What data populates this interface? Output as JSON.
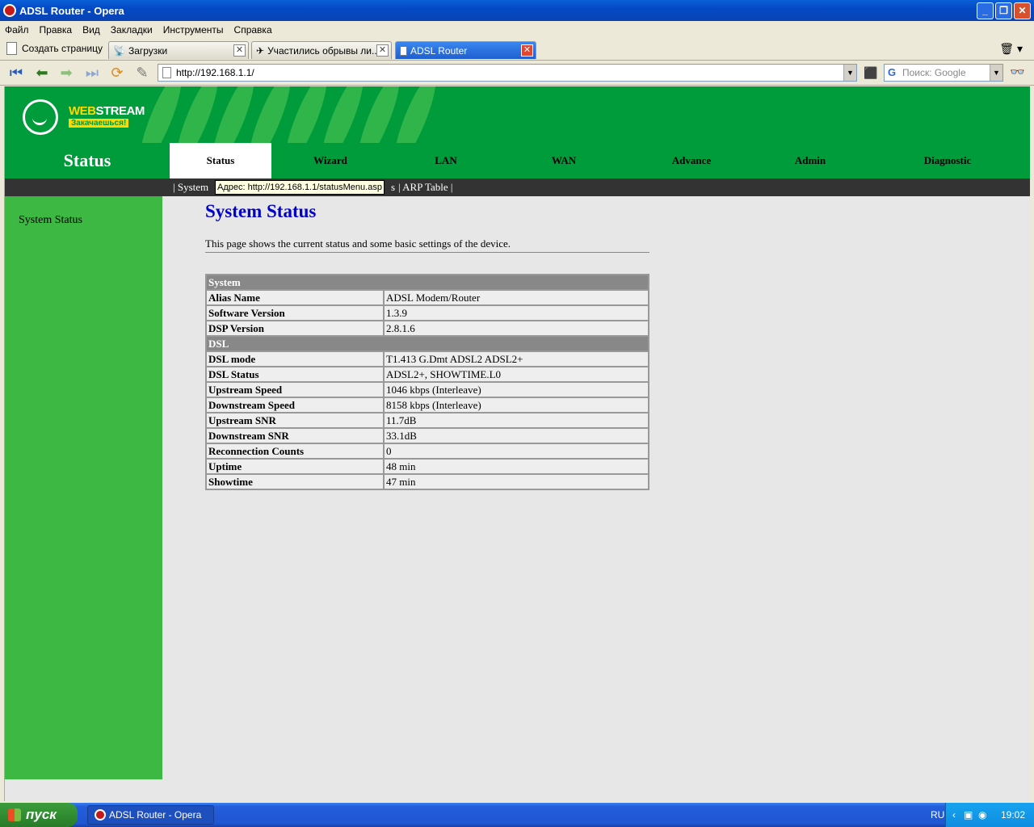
{
  "window": {
    "title": "ADSL Router - Opera"
  },
  "menu": [
    "Файл",
    "Правка",
    "Вид",
    "Закладки",
    "Инструменты",
    "Справка"
  ],
  "tabbar": {
    "new_page": "Создать страницу",
    "tabs": [
      {
        "label": "Загрузки"
      },
      {
        "label": "Участились обрывы ли..."
      },
      {
        "label": "ADSL Router"
      }
    ]
  },
  "navbar": {
    "address": "http://192.168.1.1/",
    "search_placeholder": "Поиск: Google"
  },
  "router": {
    "logo_web": "WEB",
    "logo_stream": "STREAM",
    "logo_tagline": "Закачаешься!",
    "section_title": "Status",
    "menu": [
      "Status",
      "Wizard",
      "LAN",
      "WAN",
      "Advance",
      "Admin",
      "Diagnostic"
    ],
    "submenu_left": "| System",
    "submenu_tail": "s",
    "submenu_right": "| ARP Table |",
    "tooltip": "Адрес: http://192.168.1.1/statusMenu.asp",
    "sidebar_item": "System Status",
    "page_title": "System Status",
    "description": "This page shows the current status and some basic settings of the device.",
    "table": [
      {
        "header": "System"
      },
      {
        "key": "Alias Name",
        "value": "ADSL Modem/Router"
      },
      {
        "key": "Software Version",
        "value": "1.3.9"
      },
      {
        "key": "DSP Version",
        "value": "2.8.1.6"
      },
      {
        "header": "DSL"
      },
      {
        "key": "DSL mode",
        "value": "T1.413 G.Dmt ADSL2 ADSL2+"
      },
      {
        "key": "DSL Status",
        "value": "ADSL2+, SHOWTIME.L0"
      },
      {
        "key": "Upstream Speed",
        "value": "1046 kbps  (Interleave)"
      },
      {
        "key": "Downstream Speed",
        "value": "8158 kbps  (Interleave)"
      },
      {
        "key": "Upstream SNR",
        "value": "11.7dB"
      },
      {
        "key": "Downstream SNR",
        "value": "33.1dB"
      },
      {
        "key": "Reconnection Counts",
        "value": "0"
      },
      {
        "key": "Uptime",
        "value": "48 min"
      },
      {
        "key": "Showtime",
        "value": "47 min"
      }
    ]
  },
  "taskbar": {
    "start": "пуск",
    "item": "ADSL Router - Opera",
    "lang": "RU",
    "clock": "19:02"
  },
  "colors": {
    "router_green": "#009b3a",
    "sidebar_green": "#3cb843",
    "title_blue": "#0000cc"
  }
}
